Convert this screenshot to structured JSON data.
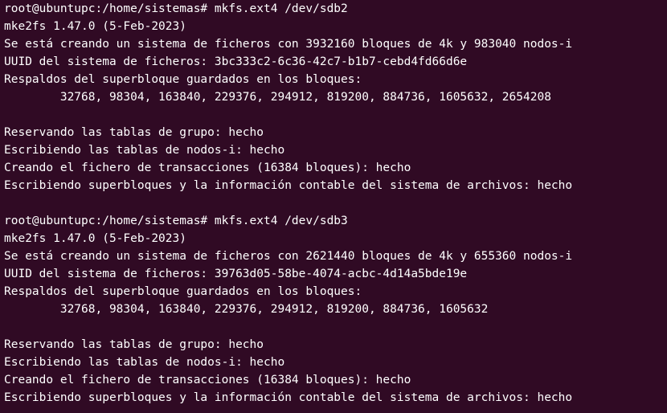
{
  "terminal": {
    "lines": [
      "root@ubuntupc:/home/sistemas# mkfs.ext4 /dev/sdb2",
      "mke2fs 1.47.0 (5-Feb-2023)",
      "Se está creando un sistema de ficheros con 3932160 bloques de 4k y 983040 nodos-i",
      "UUID del sistema de ficheros: 3bc333c2-6c36-42c7-b1b7-cebd4fd66d6e",
      "Respaldos del superbloque guardados en los bloques:",
      "        32768, 98304, 163840, 229376, 294912, 819200, 884736, 1605632, 2654208",
      "",
      "Reservando las tablas de grupo: hecho",
      "Escribiendo las tablas de nodos-i: hecho",
      "Creando el fichero de transacciones (16384 bloques): hecho",
      "Escribiendo superbloques y la información contable del sistema de archivos: hecho",
      "",
      "root@ubuntupc:/home/sistemas# mkfs.ext4 /dev/sdb3",
      "mke2fs 1.47.0 (5-Feb-2023)",
      "Se está creando un sistema de ficheros con 2621440 bloques de 4k y 655360 nodos-i",
      "UUID del sistema de ficheros: 39763d05-58be-4074-acbc-4d14a5bde19e",
      "Respaldos del superbloque guardados en los bloques:",
      "        32768, 98304, 163840, 229376, 294912, 819200, 884736, 1605632",
      "",
      "Reservando las tablas de grupo: hecho",
      "Escribiendo las tablas de nodos-i: hecho",
      "Creando el fichero de transacciones (16384 bloques): hecho",
      "Escribiendo superbloques y la información contable del sistema de archivos: hecho"
    ]
  }
}
